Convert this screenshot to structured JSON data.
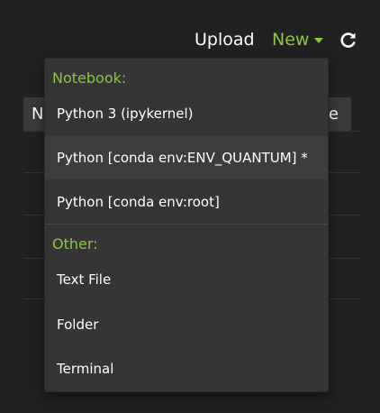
{
  "toolbar": {
    "upload_label": "Upload",
    "new_label": "New",
    "refresh_icon": "refresh-icon"
  },
  "file_list": {
    "header_left_fragment": "N",
    "header_right_fragment": "te"
  },
  "new_menu": {
    "notebook_header": "Notebook:",
    "notebook_items": [
      {
        "label": "Python 3 (ipykernel)"
      },
      {
        "label": "Python [conda env:ENV_QUANTUM] *"
      },
      {
        "label": "Python [conda env:root]"
      }
    ],
    "other_header": "Other:",
    "other_items": [
      {
        "label": "Text File"
      },
      {
        "label": "Folder"
      },
      {
        "label": "Terminal"
      }
    ]
  },
  "colors": {
    "background": "#212121",
    "menu_background": "#353535",
    "accent_green": "#8cc63f",
    "text": "#ffffff"
  }
}
